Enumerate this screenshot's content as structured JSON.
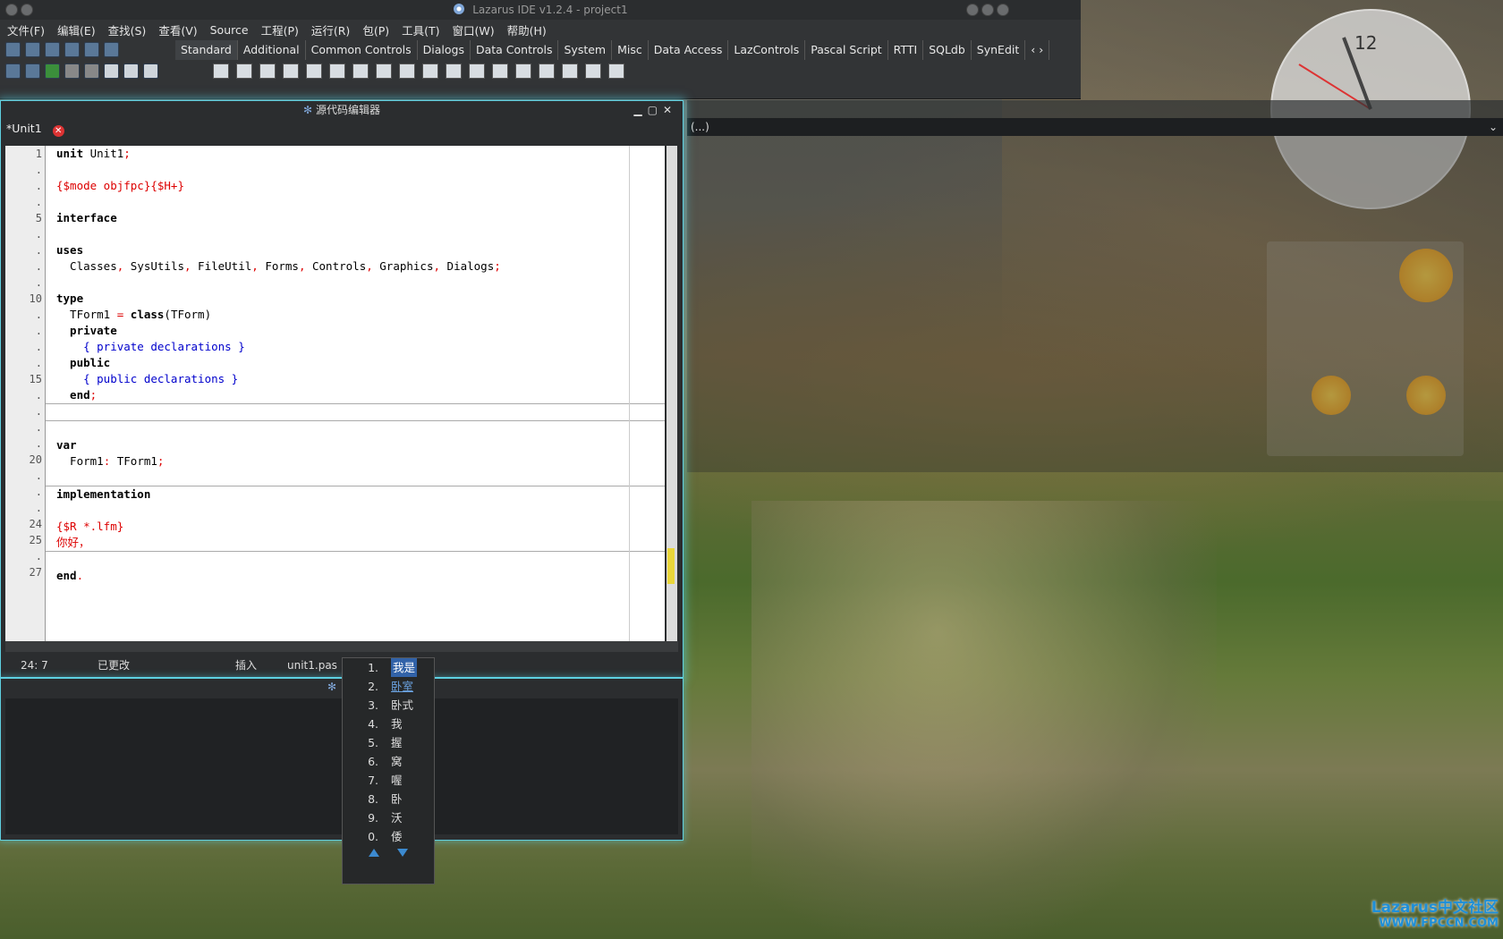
{
  "main_window": {
    "title": "Lazarus IDE v1.2.4 - project1",
    "menu": [
      "文件(F)",
      "编辑(E)",
      "查找(S)",
      "查看(V)",
      "Source",
      "工程(P)",
      "运行(R)",
      "包(P)",
      "工具(T)",
      "窗口(W)",
      "帮助(H)"
    ],
    "palette_tabs": [
      "Standard",
      "Additional",
      "Common Controls",
      "Dialogs",
      "Data Controls",
      "System",
      "Misc",
      "Data Access",
      "LazControls",
      "Pascal Script",
      "RTTI",
      "SQLdb",
      "SynEdit"
    ],
    "palette_tabs_overflow": "‹ ›"
  },
  "editor": {
    "title": "源代码编辑器",
    "tab_label": "*Unit1",
    "gutter_numbers": [
      "1",
      ".",
      ".",
      ".",
      "5",
      ".",
      ".",
      ".",
      ".",
      "10",
      ".",
      ".",
      ".",
      ".",
      "15",
      ".",
      ".",
      ".",
      ".",
      "20",
      ".",
      ".",
      ".",
      "24",
      "25",
      ".",
      "27"
    ],
    "status": {
      "position": "24:  7",
      "modified": "已更改",
      "mode": "插入",
      "file": "unit1.pas"
    }
  },
  "code_lines": [
    {
      "parts": [
        {
          "t": "unit",
          "c": "kw"
        },
        {
          "t": " Unit1",
          "c": ""
        },
        {
          "t": ";",
          "c": "sym"
        }
      ]
    },
    {
      "parts": []
    },
    {
      "parts": [
        {
          "t": "{$mode objfpc}{$H+}",
          "c": "dir"
        }
      ]
    },
    {
      "parts": []
    },
    {
      "parts": [
        {
          "t": "interface",
          "c": "kw"
        }
      ]
    },
    {
      "parts": []
    },
    {
      "parts": [
        {
          "t": "uses",
          "c": "kw"
        }
      ]
    },
    {
      "parts": [
        {
          "t": "  Classes",
          "c": ""
        },
        {
          "t": ",",
          "c": "sym"
        },
        {
          "t": " SysUtils",
          "c": ""
        },
        {
          "t": ",",
          "c": "sym"
        },
        {
          "t": " FileUtil",
          "c": ""
        },
        {
          "t": ",",
          "c": "sym"
        },
        {
          "t": " Forms",
          "c": ""
        },
        {
          "t": ",",
          "c": "sym"
        },
        {
          "t": " Controls",
          "c": ""
        },
        {
          "t": ",",
          "c": "sym"
        },
        {
          "t": " Graphics",
          "c": ""
        },
        {
          "t": ",",
          "c": "sym"
        },
        {
          "t": " Dialogs",
          "c": ""
        },
        {
          "t": ";",
          "c": "sym"
        }
      ]
    },
    {
      "parts": []
    },
    {
      "parts": [
        {
          "t": "type",
          "c": "kw"
        }
      ]
    },
    {
      "parts": [
        {
          "t": "  TForm1 ",
          "c": ""
        },
        {
          "t": "=",
          "c": "sym"
        },
        {
          "t": " class",
          "c": "kw"
        },
        {
          "t": "(TForm)",
          "c": ""
        }
      ]
    },
    {
      "parts": [
        {
          "t": "  private",
          "c": "kw"
        }
      ]
    },
    {
      "parts": [
        {
          "t": "    { private declarations }",
          "c": "cm"
        }
      ]
    },
    {
      "parts": [
        {
          "t": "  public",
          "c": "kw"
        }
      ]
    },
    {
      "parts": [
        {
          "t": "    { public declarations }",
          "c": "cm"
        }
      ]
    },
    {
      "parts": [
        {
          "t": "  end",
          "c": "kw"
        },
        {
          "t": ";",
          "c": "sym"
        }
      ]
    },
    {
      "parts": [],
      "sep": true
    },
    {
      "parts": [],
      "sep": true
    },
    {
      "parts": [
        {
          "t": "var",
          "c": "kw"
        }
      ]
    },
    {
      "parts": [
        {
          "t": "  Form1",
          "c": ""
        },
        {
          "t": ":",
          "c": "sym"
        },
        {
          "t": " TForm1",
          "c": ""
        },
        {
          "t": ";",
          "c": "sym"
        }
      ]
    },
    {
      "parts": []
    },
    {
      "parts": [
        {
          "t": "implementation",
          "c": "kw"
        }
      ],
      "sep": true
    },
    {
      "parts": []
    },
    {
      "parts": [
        {
          "t": "{$R *.lfm}",
          "c": "dir"
        }
      ]
    },
    {
      "parts": [
        {
          "t": "你好，",
          "c": "dir"
        }
      ]
    },
    {
      "parts": [],
      "sep": true
    },
    {
      "parts": [
        {
          "t": "end",
          "c": "kw"
        },
        {
          "t": ".",
          "c": "sym"
        }
      ]
    }
  ],
  "ime_candidates": [
    {
      "n": "1.",
      "t": "我是",
      "state": "selected"
    },
    {
      "n": "2.",
      "t": "卧室",
      "state": "hover"
    },
    {
      "n": "3.",
      "t": "卧式",
      "state": ""
    },
    {
      "n": "4.",
      "t": "我",
      "state": ""
    },
    {
      "n": "5.",
      "t": "握",
      "state": ""
    },
    {
      "n": "6.",
      "t": "窝",
      "state": ""
    },
    {
      "n": "7.",
      "t": "喔",
      "state": ""
    },
    {
      "n": "8.",
      "t": "卧",
      "state": ""
    },
    {
      "n": "9.",
      "t": "沃",
      "state": ""
    },
    {
      "n": "0.",
      "t": "倭",
      "state": ""
    }
  ],
  "object_inspector": {
    "combo_value": "(...)"
  },
  "clock": {
    "number": "12"
  },
  "brand": {
    "line1": "Lazarus中文社区",
    "line2": "WWW.FPCCN.COM"
  },
  "colors": {
    "editor_glow": "#5fd0e0",
    "ime_selected": "#3162a8",
    "brand": "#1e8fd8"
  }
}
